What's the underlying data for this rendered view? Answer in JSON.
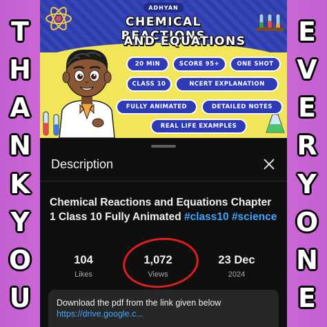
{
  "side_text": {
    "left": [
      "T",
      "H",
      "A",
      "N",
      "K",
      "Y",
      "O",
      "U"
    ],
    "right": [
      "E",
      "V",
      "E",
      "R",
      "Y",
      "O",
      "N",
      "E"
    ]
  },
  "thumbnail": {
    "brand": "ADHYAN",
    "title_line1": "CHEMICAL REACTIONS",
    "title_line2": "AND EQUATIONS",
    "pills": [
      "20 MIN",
      "SCORE 95+",
      "ONE SHOT",
      "CLASS 10",
      "NCERT EXPLANATION",
      "FULLY ANIMATED",
      "DETAILED NOTES",
      "REAL LIFE EXAMPLES"
    ]
  },
  "description_panel": {
    "header": "Description",
    "video_title_text": "Chemical Reactions and Equations Chapter 1 Class 10 Fully Animated ",
    "hashtags": [
      "#class10",
      "#science"
    ],
    "stats": [
      {
        "value": "104",
        "label": "Likes"
      },
      {
        "value": "1,072",
        "label": "Views"
      },
      {
        "value": "23 Dec",
        "label": "2024"
      }
    ],
    "description_line": "Download the pdf from the link given below",
    "link": "https://drive.google.c..."
  },
  "colors": {
    "background": "#d070d6",
    "panel": "#0f0f0f",
    "hashtag": "#3ea6ff",
    "circle": "#e01e1e",
    "thumb_yellow": "#f1e55a",
    "thumb_blue": "#2d3db0"
  }
}
